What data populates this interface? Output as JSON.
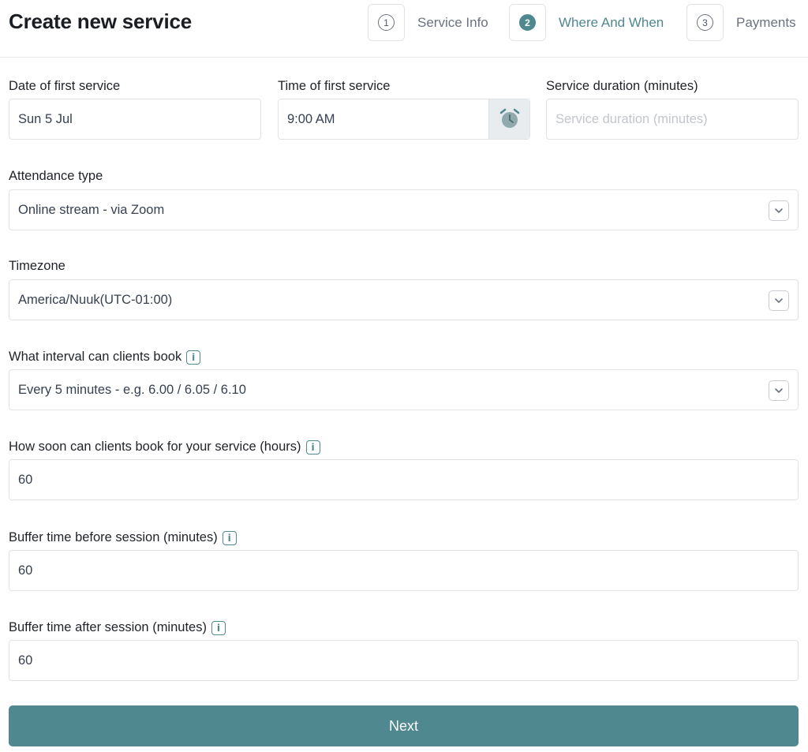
{
  "page_title": "Create new service",
  "steps": [
    {
      "number": "1",
      "label": "Service Info"
    },
    {
      "number": "2",
      "label": "Where And When"
    },
    {
      "number": "3",
      "label": "Payments"
    }
  ],
  "active_step": 2,
  "date_field": {
    "label": "Date of first service",
    "value": "Sun 5 Jul"
  },
  "time_field": {
    "label": "Time of first service",
    "value": "9:00 AM",
    "icon": "alarm-clock-icon"
  },
  "duration_field": {
    "label": "Service duration (minutes)",
    "placeholder": "Service duration (minutes)",
    "value": ""
  },
  "attendance": {
    "label": "Attendance type",
    "value": "Online stream - via Zoom"
  },
  "timezone": {
    "label": "Timezone",
    "value": "America/Nuuk(UTC-01:00)"
  },
  "interval": {
    "label": "What interval can clients book",
    "value": "Every 5 minutes - e.g. 6.00 / 6.05 / 6.10",
    "info_icon": "i"
  },
  "lead_time": {
    "label": "How soon can clients book for your service (hours)",
    "value": "60",
    "info_icon": "i"
  },
  "buffer_before": {
    "label": "Buffer time before session (minutes)",
    "value": "60",
    "info_icon": "i"
  },
  "buffer_after": {
    "label": "Buffer time after session (minutes)",
    "value": "60",
    "info_icon": "i"
  },
  "next_button": {
    "label": "Next"
  },
  "colors": {
    "accent": "#4f888f",
    "border": "#e0e3e6",
    "text": "#1f2328",
    "placeholder": "#c2c6cc"
  }
}
